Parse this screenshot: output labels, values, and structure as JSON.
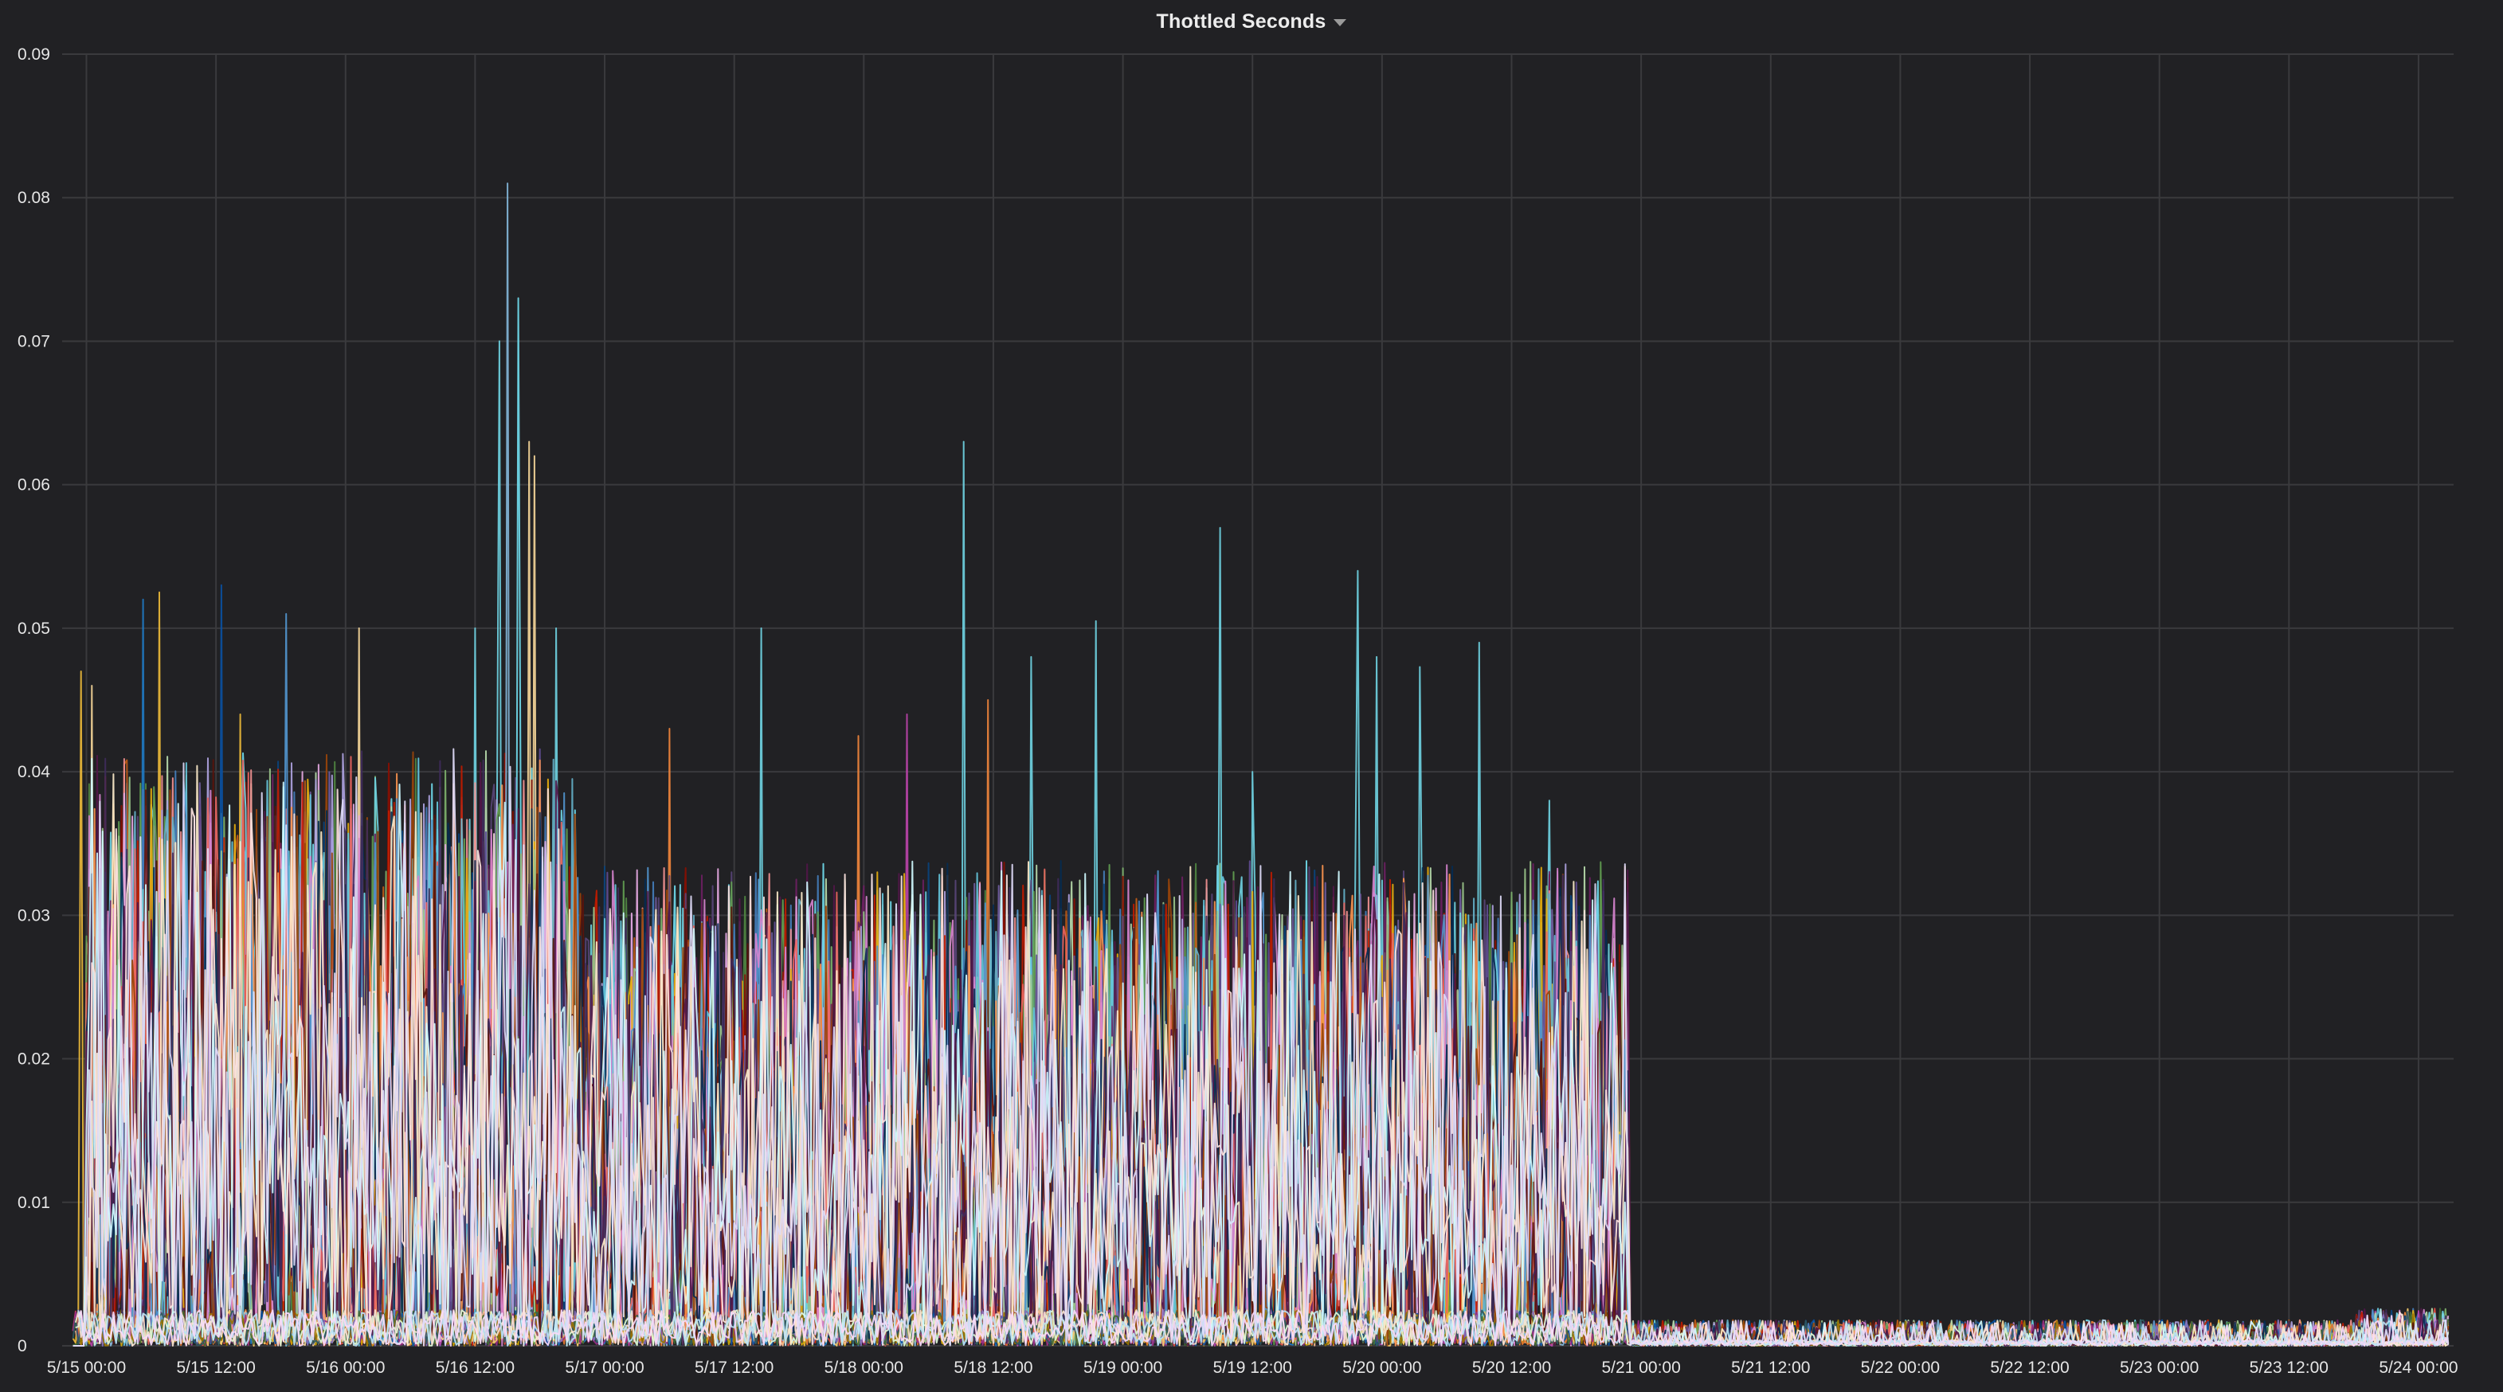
{
  "panel": {
    "title": "Thottled Seconds"
  },
  "chart_data": {
    "type": "line",
    "title": "Thottled Seconds",
    "xlabel": "",
    "ylabel": "",
    "y_ticks": [
      "0",
      "0.01",
      "0.02",
      "0.03",
      "0.04",
      "0.05",
      "0.06",
      "0.07",
      "0.08",
      "0.09"
    ],
    "ylim": [
      0,
      0.09
    ],
    "x_ticks": [
      "5/15 00:00",
      "5/15 12:00",
      "5/16 00:00",
      "5/16 12:00",
      "5/17 00:00",
      "5/17 12:00",
      "5/18 00:00",
      "5/18 12:00",
      "5/19 00:00",
      "5/19 12:00",
      "5/20 00:00",
      "5/20 12:00",
      "5/21 00:00",
      "5/21 12:00",
      "5/22 00:00",
      "5/22 12:00",
      "5/23 00:00",
      "5/23 12:00",
      "5/24 00:00"
    ],
    "xlim": [
      "5/14 21:45",
      "5/24 03:15"
    ],
    "grid": true,
    "legend": "none",
    "background": "#212124",
    "grid_color": "#3a3a3d",
    "palette": [
      "#7eb26d",
      "#eab839",
      "#6ed0e0",
      "#ef843c",
      "#e24d42",
      "#1f78c1",
      "#ba43a9",
      "#705da0",
      "#508642",
      "#cca300",
      "#447ebc",
      "#c15c17",
      "#890f02",
      "#0a437c",
      "#6d1f62",
      "#584477",
      "#b7dbab",
      "#f4d598",
      "#70dbed",
      "#f9ba8f",
      "#f29191",
      "#82b5d8",
      "#e5a8e2",
      "#aea2e0",
      "#629e51",
      "#e5ac0e",
      "#64b0c8",
      "#e0752d",
      "#bf1b00",
      "#0a50a1",
      "#962d82",
      "#614d93",
      "#9ac48a",
      "#f2c96d",
      "#65c5db",
      "#f9934e",
      "#ea6460",
      "#5195ce",
      "#d683ce",
      "#806eb7",
      "#3f6833",
      "#967302",
      "#2f575e",
      "#99440a",
      "#58140c",
      "#052b51",
      "#511749",
      "#3f2b5b",
      "#e0f9d7",
      "#fceaca",
      "#cffaff",
      "#f9e2d2",
      "#fce2de",
      "#badff4",
      "#f9d9f9",
      "#dedaf7"
    ],
    "series_count": 56,
    "phases": [
      {
        "from": "5/15 00:00",
        "to": "5/16 21:30",
        "typical_peak": 0.032
      },
      {
        "from": "5/16 21:30",
        "to": "5/20 23:00",
        "typical_peak": 0.026
      },
      {
        "from": "5/20 23:00",
        "to": "5/24 03:00",
        "typical_peak": 0.0012
      }
    ],
    "peaks": [
      {
        "x": "5/14 23:30",
        "y": 0.047,
        "series": 1
      },
      {
        "x": "5/15 00:30",
        "y": 0.046,
        "series": 17
      },
      {
        "x": "5/15 05:15",
        "y": 0.052,
        "series": 5
      },
      {
        "x": "5/15 06:45",
        "y": 0.0525,
        "series": 1
      },
      {
        "x": "5/15 12:30",
        "y": 0.053,
        "series": 29
      },
      {
        "x": "5/15 14:15",
        "y": 0.044,
        "series": 1
      },
      {
        "x": "5/15 18:30",
        "y": 0.051,
        "series": 37
      },
      {
        "x": "5/16 01:15",
        "y": 0.05,
        "series": 17
      },
      {
        "x": "5/16 12:00",
        "y": 0.05,
        "series": 2
      },
      {
        "x": "5/16 14:15",
        "y": 0.07,
        "series": 2
      },
      {
        "x": "5/16 15:00",
        "y": 0.081,
        "series": 21
      },
      {
        "x": "5/16 16:00",
        "y": 0.073,
        "series": 18
      },
      {
        "x": "5/16 17:00",
        "y": 0.063,
        "series": 17
      },
      {
        "x": "5/16 17:30",
        "y": 0.062,
        "series": 17
      },
      {
        "x": "5/16 19:30",
        "y": 0.05,
        "series": 2
      },
      {
        "x": "5/17 06:00",
        "y": 0.043,
        "series": 3
      },
      {
        "x": "5/17 14:30",
        "y": 0.05,
        "series": 2
      },
      {
        "x": "5/17 23:30",
        "y": 0.0425,
        "series": 3
      },
      {
        "x": "5/18 04:00",
        "y": 0.044,
        "series": 6
      },
      {
        "x": "5/18 09:15",
        "y": 0.063,
        "series": 2
      },
      {
        "x": "5/18 11:30",
        "y": 0.045,
        "series": 3
      },
      {
        "x": "5/18 15:30",
        "y": 0.048,
        "series": 2
      },
      {
        "x": "5/18 21:30",
        "y": 0.0505,
        "series": 2
      },
      {
        "x": "5/19 09:00",
        "y": 0.057,
        "series": 2
      },
      {
        "x": "5/19 12:00",
        "y": 0.04,
        "series": 2
      },
      {
        "x": "5/19 21:45",
        "y": 0.054,
        "series": 2
      },
      {
        "x": "5/19 23:30",
        "y": 0.048,
        "series": 2
      },
      {
        "x": "5/20 03:30",
        "y": 0.0473,
        "series": 2
      },
      {
        "x": "5/20 09:00",
        "y": 0.049,
        "series": 2
      },
      {
        "x": "5/20 15:30",
        "y": 0.038,
        "series": 2
      }
    ]
  }
}
